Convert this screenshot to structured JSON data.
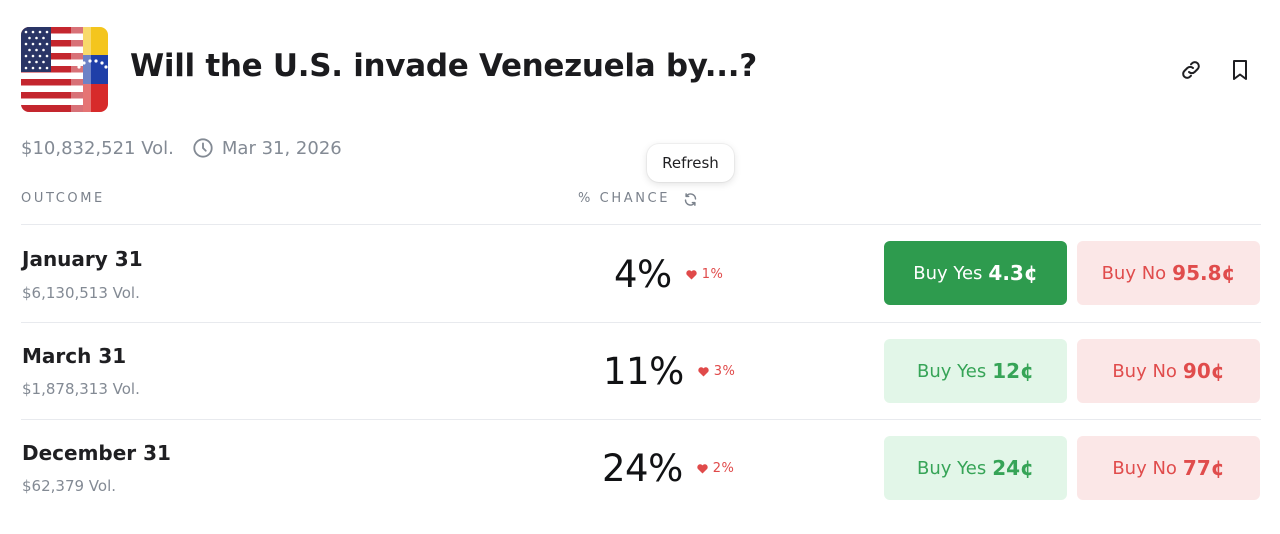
{
  "header": {
    "title": "Will the U.S. invade Venezuela by...?",
    "flag_icon": "us-venezuela-flag-icon",
    "actions": [
      {
        "icon": "link-icon"
      },
      {
        "icon": "bookmark-icon"
      }
    ]
  },
  "meta": {
    "volume": "$10,832,521 Vol.",
    "clock_icon": "clock-icon",
    "end_date": "Mar 31, 2026"
  },
  "tooltip": {
    "text": "Refresh"
  },
  "table": {
    "outcome_header": "OUTCOME",
    "chance_header": "% CHANCE",
    "refresh_icon": "refresh-icon",
    "rows": [
      {
        "label": "January 31",
        "volume": "$6,130,513 Vol.",
        "chance": "4%",
        "delta": "1%",
        "delta_direction": "down",
        "yes_label": "Buy Yes",
        "yes_price": "4.3¢",
        "no_label": "Buy No",
        "no_price": "95.8¢",
        "yes_active": true
      },
      {
        "label": "March 31",
        "volume": "$1,878,313 Vol.",
        "chance": "11%",
        "delta": "3%",
        "delta_direction": "down",
        "yes_label": "Buy Yes",
        "yes_price": "12¢",
        "no_label": "Buy No",
        "no_price": "90¢",
        "yes_active": false
      },
      {
        "label": "December 31",
        "volume": "$62,379 Vol.",
        "chance": "24%",
        "delta": "2%",
        "delta_direction": "down",
        "yes_label": "Buy Yes",
        "yes_price": "24¢",
        "no_label": "Buy No",
        "no_price": "77¢",
        "yes_active": false
      }
    ]
  },
  "colors": {
    "yes_active_bg": "#2e9b4e",
    "yes_bg": "#e2f6e8",
    "yes_text": "#36a457",
    "no_bg": "#fbe7e7",
    "no_text": "#e04c4c",
    "delta_down": "#e04a4a"
  }
}
